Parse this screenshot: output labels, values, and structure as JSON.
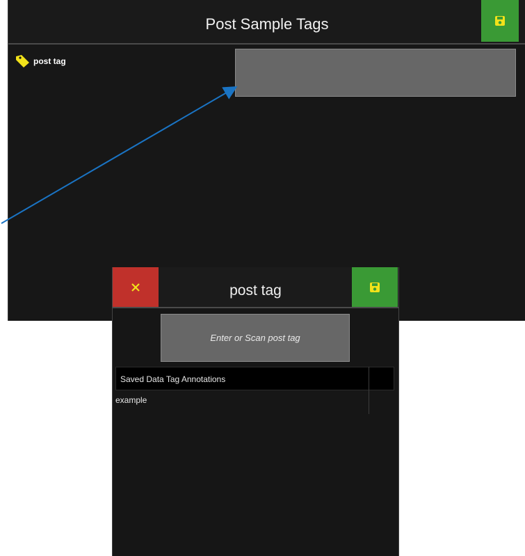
{
  "main": {
    "title": "Post Sample Tags",
    "save_icon": "floppy-disk-icon",
    "field_label": "post tag",
    "field_icon": "tag-icon",
    "field_value": ""
  },
  "dialog": {
    "title": "post tag",
    "cancel_icon": "close-icon",
    "save_icon": "floppy-disk-icon",
    "scan_placeholder": "Enter or Scan post tag",
    "table": {
      "header": "Saved Data Tag Annotations",
      "rows": [
        "example"
      ]
    }
  },
  "colors": {
    "save_green": "#3a9a35",
    "cancel_red": "#c0312b",
    "icon_yellow": "#f2e21a",
    "arrow_blue": "#1a74c4"
  }
}
